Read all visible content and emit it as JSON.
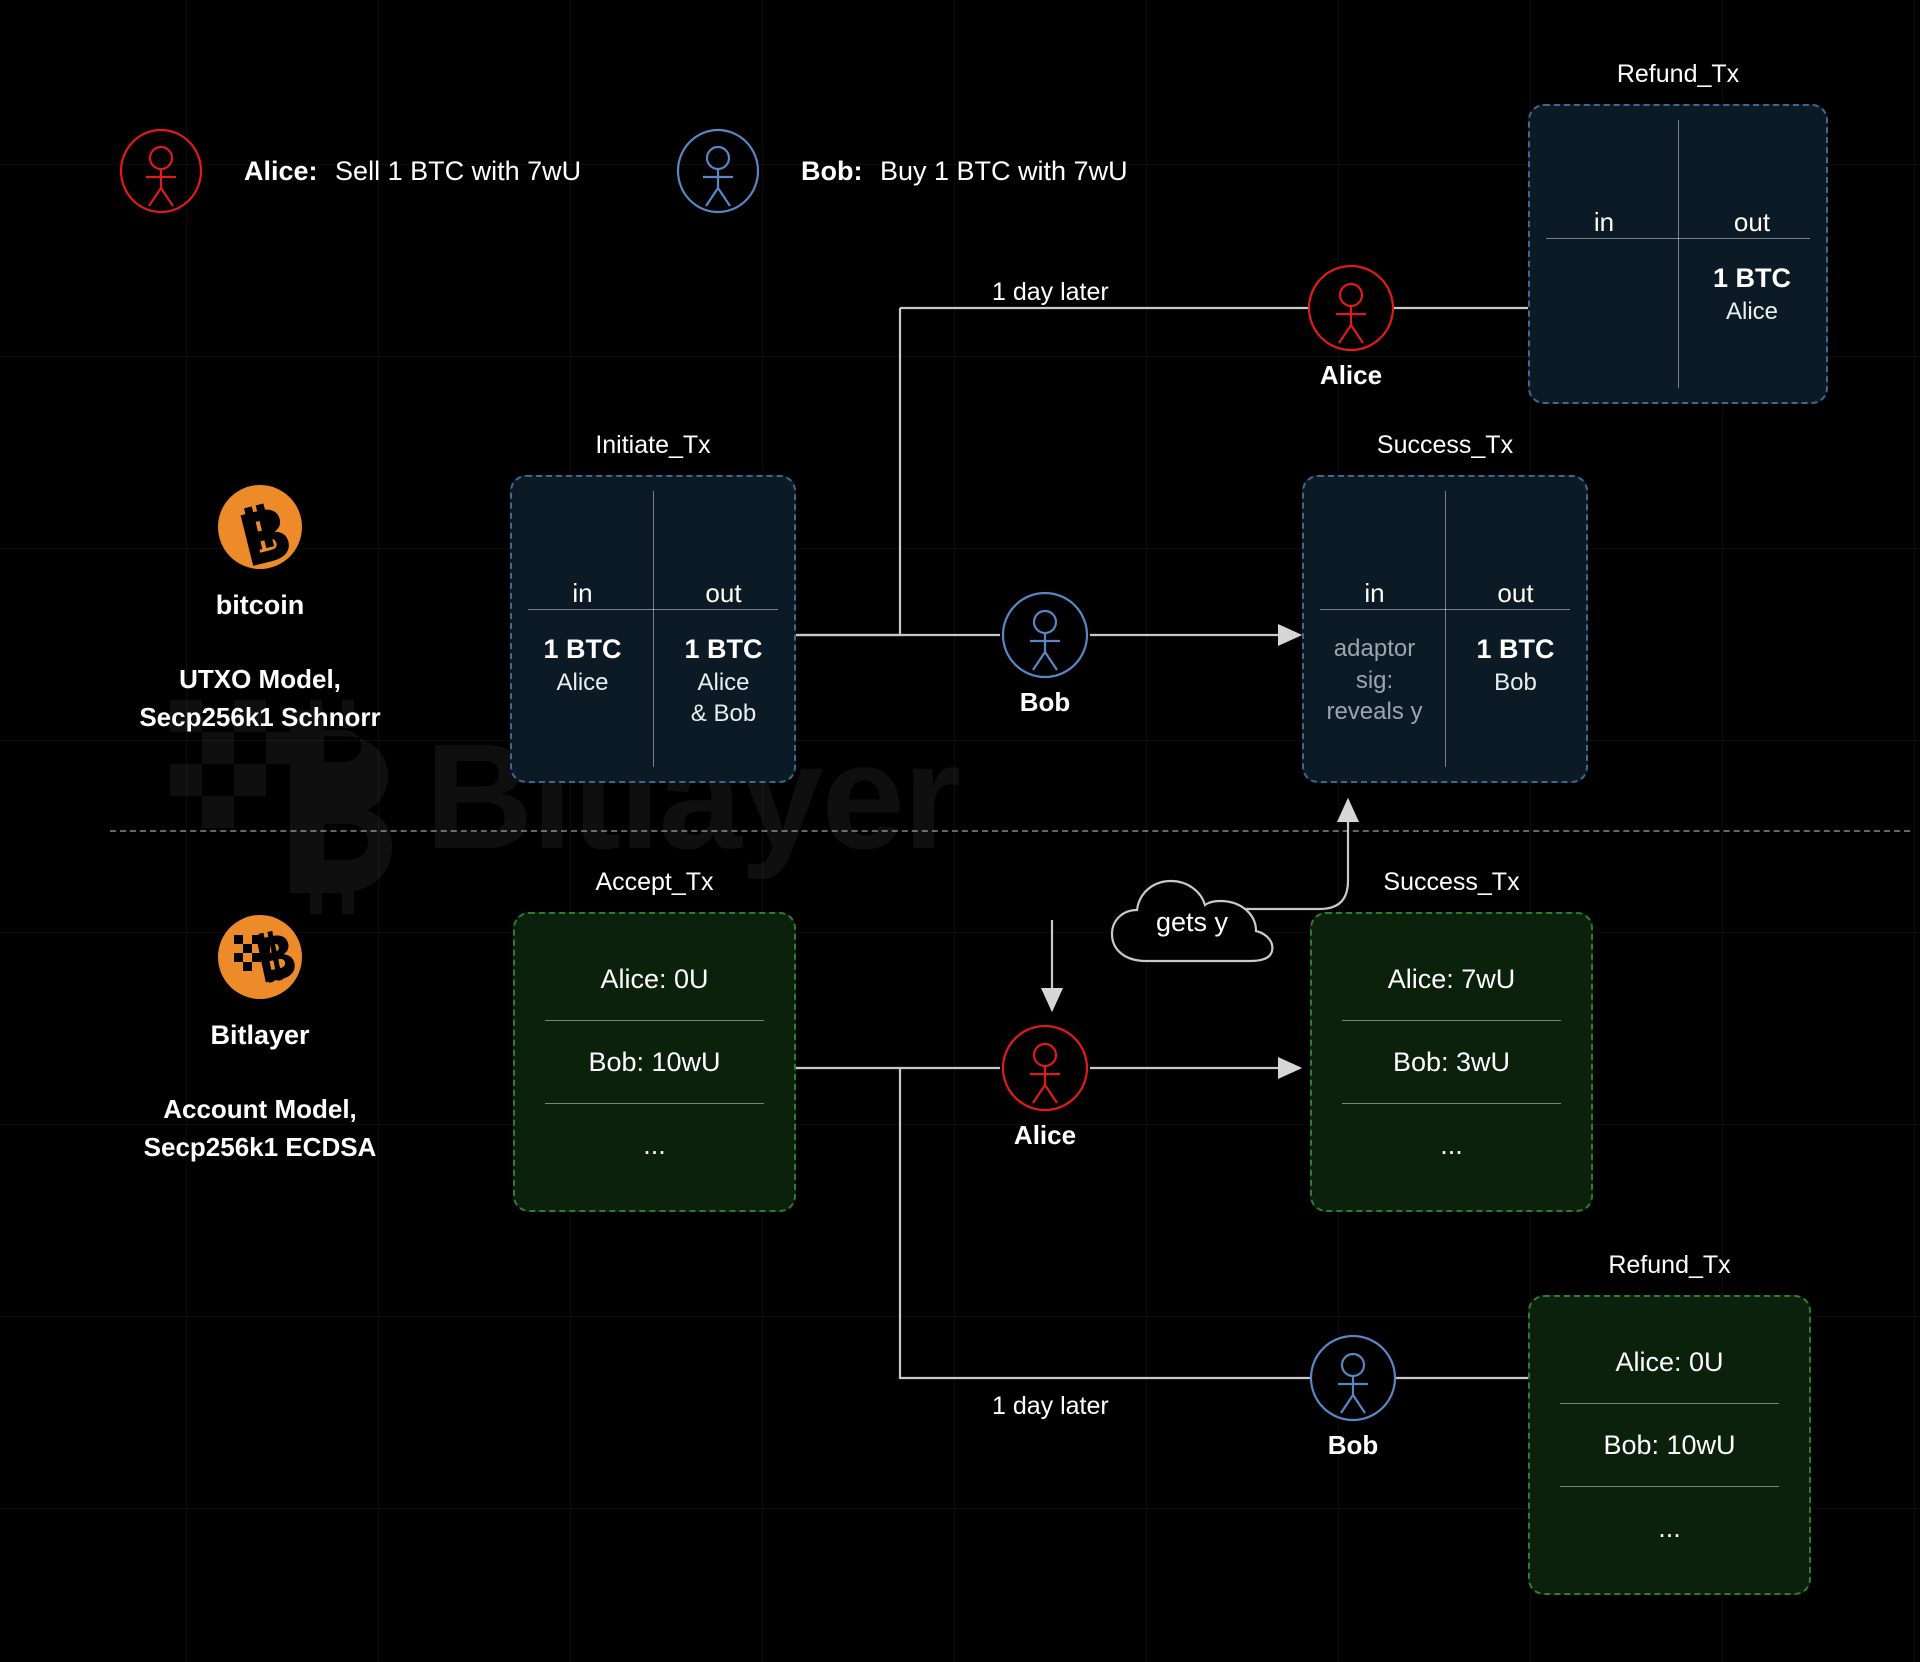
{
  "legend": [
    {
      "icon": "alice-stick-figure-icon",
      "name": "Alice:",
      "desc": "Sell 1 BTC with 7wU",
      "color": "#e01b1b"
    },
    {
      "icon": "bob-stick-figure-icon",
      "name": "Bob:",
      "desc": "Buy 1 BTC with 7wU",
      "color": "#5b86c4"
    }
  ],
  "watermark": {
    "text": "Bitlayer"
  },
  "chains": [
    {
      "logo": "bitcoin-logo-icon",
      "name": "bitcoin",
      "model_line1": "UTXO Model,",
      "model_line2": "Secp256k1 Schnorr",
      "accent": "#ed8b2b"
    },
    {
      "logo": "bitlayer-logo-icon",
      "name": "Bitlayer",
      "model_line1": "Account Model,",
      "model_line2": "Secp256k1 ECDSA",
      "accent": "#ed8b2b"
    }
  ],
  "btc_boxes": {
    "refund": {
      "title": "Refund_Tx",
      "in_label": "in",
      "out_label": "out",
      "in_amount": "",
      "in_who": "",
      "out_amount": "1 BTC",
      "out_who": "Alice"
    },
    "initiate": {
      "title": "Initiate_Tx",
      "in_label": "in",
      "out_label": "out",
      "in_amount": "1 BTC",
      "in_who": "Alice",
      "out_amount": "1 BTC",
      "out_who_line1": "Alice",
      "out_who_line2": "& Bob"
    },
    "success": {
      "title": "Success_Tx",
      "in_label": "in",
      "out_label": "out",
      "in_note_line1": "adaptor",
      "in_note_line2": "sig:",
      "in_note_line3": "reveals y",
      "out_amount": "1 BTC",
      "out_who": "Bob"
    }
  },
  "btl_boxes": {
    "accept": {
      "title": "Accept_Tx",
      "rows": [
        "Alice: 0U",
        "Bob: 10wU",
        "..."
      ]
    },
    "success": {
      "title": "Success_Tx",
      "rows": [
        "Alice: 7wU",
        "Bob: 3wU",
        "..."
      ]
    },
    "refund": {
      "title": "Refund_Tx",
      "rows": [
        "Alice: 0U",
        "Bob: 10wU",
        "..."
      ]
    }
  },
  "actors": {
    "alice_top": {
      "label": "Alice",
      "color": "#e01b1b"
    },
    "bob_mid": {
      "label": "Bob",
      "color": "#5b86c4"
    },
    "alice_mid": {
      "label": "Alice",
      "color": "#e01b1b"
    },
    "bob_bottom": {
      "label": "Bob",
      "color": "#5b86c4"
    }
  },
  "cloud": {
    "label": "gets y"
  },
  "edge_labels": {
    "day_later_top": "1 day later",
    "day_later_bottom": "1 day later"
  },
  "colors": {
    "btc_box_fill": "#0b1a24",
    "btc_box_border": "#41678f",
    "btl_box_fill": "#0c210c",
    "btl_box_border": "#2f7a35",
    "line": "#c9c9c9",
    "background": "#000000"
  }
}
